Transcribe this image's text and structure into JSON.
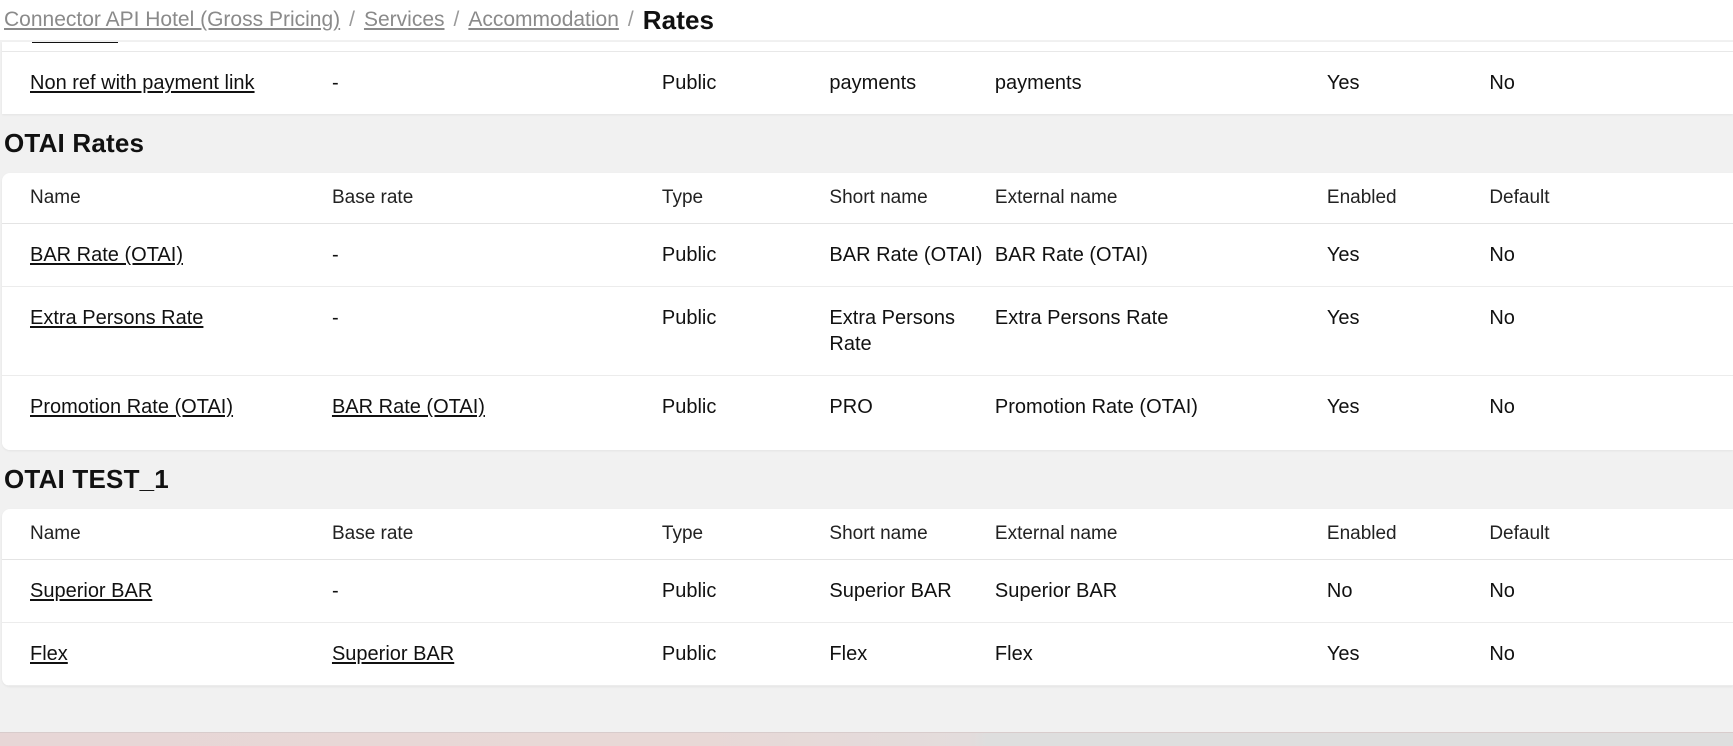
{
  "breadcrumb": {
    "items": [
      {
        "label": "Connector API Hotel (Gross Pricing)",
        "current": false
      },
      {
        "label": "Services",
        "current": false
      },
      {
        "label": "Accommodation",
        "current": false
      },
      {
        "label": "Rates",
        "current": true
      }
    ],
    "separator": "/"
  },
  "columns": {
    "name": "Name",
    "base_rate": "Base rate",
    "type": "Type",
    "short_name": "Short name",
    "external_name": "External name",
    "enabled": "Enabled",
    "default": "Default"
  },
  "top_partial_table": {
    "rows": [
      {
        "name": "Non ref with payment link",
        "base_rate": "-",
        "type": "Public",
        "short_name": "payments",
        "external_name": "payments",
        "enabled": "Yes",
        "default": "No"
      }
    ]
  },
  "sections": [
    {
      "title": "OTAI Rates",
      "rows": [
        {
          "name": "BAR Rate (OTAI)",
          "base_rate": "-",
          "type": "Public",
          "short_name": "BAR Rate (OTAI)",
          "external_name": "BAR Rate (OTAI)",
          "enabled": "Yes",
          "default": "No"
        },
        {
          "name": "Extra Persons Rate",
          "base_rate": "-",
          "type": "Public",
          "short_name": "Extra Persons Rate",
          "external_name": "Extra Persons Rate",
          "enabled": "Yes",
          "default": "No"
        },
        {
          "name": "Promotion Rate (OTAI)",
          "base_rate": "BAR Rate (OTAI)",
          "type": "Public",
          "short_name": "PRO",
          "external_name": "Promotion Rate (OTAI)",
          "enabled": "Yes",
          "default": "No"
        }
      ]
    },
    {
      "title": "OTAI TEST_1",
      "rows": [
        {
          "name": "Superior BAR",
          "base_rate": "-",
          "type": "Public",
          "short_name": "Superior BAR",
          "external_name": "Superior BAR",
          "enabled": "No",
          "default": "No"
        },
        {
          "name": "Flex",
          "base_rate": "Superior BAR",
          "type": "Public",
          "short_name": "Flex",
          "external_name": "Flex",
          "enabled": "Yes",
          "default": "No"
        }
      ]
    }
  ],
  "colors": {
    "page_background": "#f1f1f1",
    "card_background": "#ffffff",
    "text": "#111111",
    "muted_text": "#8a8a8a",
    "row_divider": "#ececec",
    "active_tab_indicator": "#111111",
    "bottom_banner": "#e7d6d6"
  }
}
